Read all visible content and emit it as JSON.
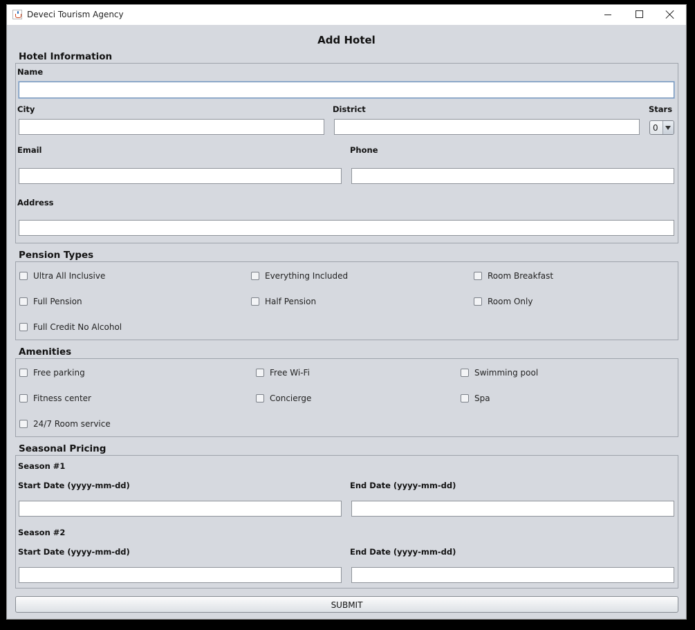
{
  "window": {
    "title": "Deveci Tourism Agency"
  },
  "heading": "Add Hotel",
  "hotel_info": {
    "title": "Hotel Information",
    "name_label": "Name",
    "city_label": "City",
    "district_label": "District",
    "stars_label": "Stars",
    "stars_value": "0",
    "email_label": "Email",
    "phone_label": "Phone",
    "address_label": "Address"
  },
  "pension": {
    "title": "Pension Types",
    "options": [
      "Ultra All Inclusive",
      "Everything Included",
      "Room Breakfast",
      "Full Pension",
      "Half Pension",
      "Room Only",
      "Full Credit No Alcohol"
    ]
  },
  "amenities": {
    "title": "Amenities",
    "options": [
      "Free parking",
      "Free Wi-Fi",
      "Swimming pool",
      "Fitness center",
      "Concierge",
      "Spa",
      "24/7 Room service"
    ]
  },
  "pricing": {
    "title": "Seasonal Pricing",
    "season1": {
      "label": "Season #1",
      "start_label": "Start Date (yyyy-mm-dd)",
      "end_label": "End Date (yyyy-mm-dd)"
    },
    "season2": {
      "label": "Season #2",
      "start_label": "Start Date (yyyy-mm-dd)",
      "end_label": "End Date (yyyy-mm-dd)"
    }
  },
  "submit_label": "SUBMIT",
  "icons": {
    "app": "java-cup-icon",
    "minimize": "minimize-icon",
    "maximize": "maximize-icon",
    "close": "close-icon"
  }
}
